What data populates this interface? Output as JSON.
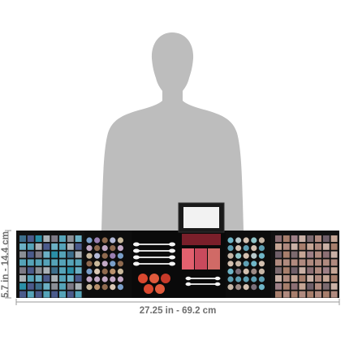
{
  "product": {
    "palettes": [
      {
        "id": "eyeshadow-grid-left",
        "colors": [
          "#3d6f8c",
          "#55a3b8",
          "#2a8fa7",
          "#6bb0c4",
          "#7d7a86",
          "#4b5b8c",
          "#8a8f96",
          "#a9b1b6"
        ]
      },
      {
        "id": "eyeshadow-circles-left",
        "colors": [
          "#7a9fc9",
          "#b3b9d6",
          "#c3a9c6",
          "#9a7fb1",
          "#c9b99c",
          "#b9916d",
          "#8f6a4f",
          "#d9c7b4"
        ]
      },
      {
        "id": "blush-circles",
        "colors": [
          "#d9482f",
          "#e05a3c",
          "#c83a29"
        ]
      },
      {
        "id": "blush-trio",
        "colors": [
          "#e2606e",
          "#c94a5d",
          "#d06a66"
        ]
      },
      {
        "id": "eyeshadow-circles-right",
        "colors": [
          "#6fb6c8",
          "#8fc5c9",
          "#5e9fb3",
          "#b7c9cc",
          "#c7b6a6",
          "#9d8b86",
          "#d3c0b0",
          "#7b6f7a"
        ]
      },
      {
        "id": "eyeshadow-grid-right",
        "colors": [
          "#8c6f74",
          "#b08a7f",
          "#9d7f86",
          "#c5a595",
          "#7c6a6f",
          "#a77e6c",
          "#6f5f69",
          "#c9b0a5"
        ]
      }
    ]
  },
  "dimensions": {
    "height_label": "5.7 in - 14.4 cm",
    "width_label": "27.25 in - 69.2 cm"
  }
}
